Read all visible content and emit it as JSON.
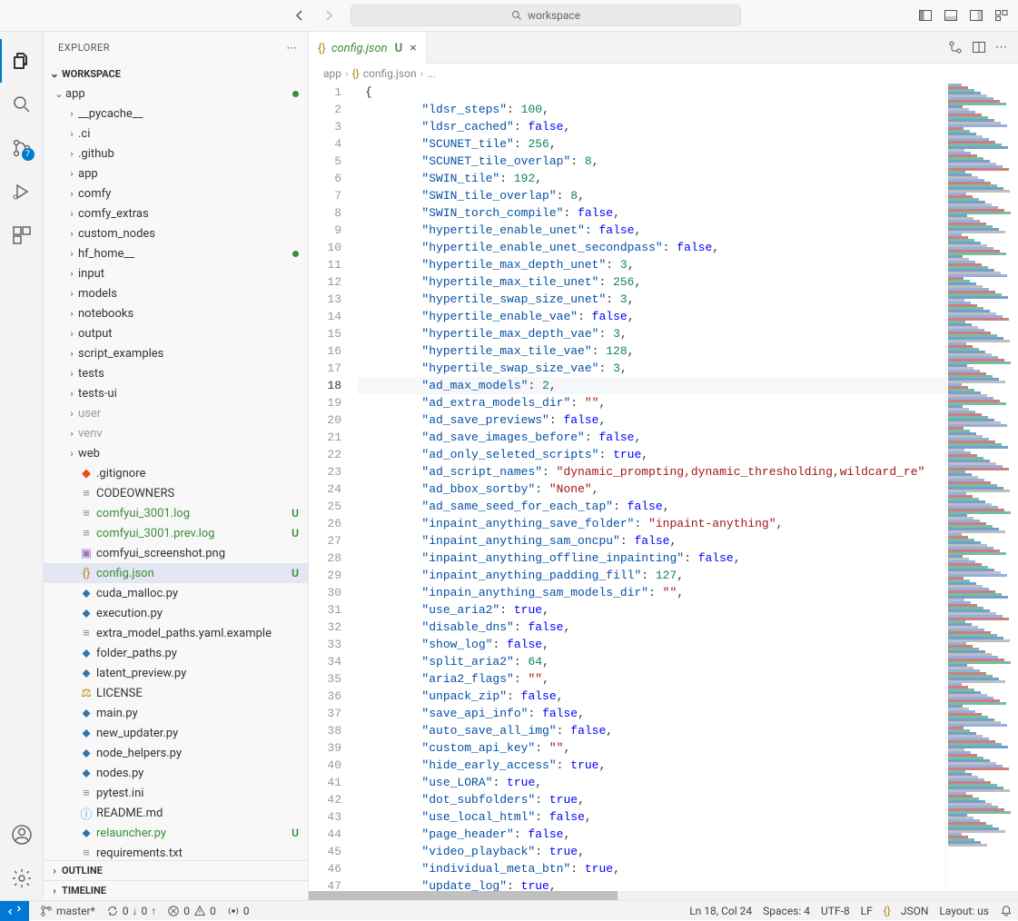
{
  "titlebar": {
    "search_text": "workspace"
  },
  "activitybar": {
    "scm_badge": "7"
  },
  "sidebar": {
    "title": "EXPLORER",
    "workspace_label": "WORKSPACE",
    "outline_label": "OUTLINE",
    "timeline_label": "TIMELINE",
    "tree": [
      {
        "type": "folder",
        "label": "app",
        "depth": 0,
        "expanded": true,
        "modified": true
      },
      {
        "type": "folder",
        "label": "__pycache__",
        "depth": 1,
        "expanded": false
      },
      {
        "type": "folder",
        "label": ".ci",
        "depth": 1,
        "expanded": false
      },
      {
        "type": "folder",
        "label": ".github",
        "depth": 1,
        "expanded": false
      },
      {
        "type": "folder",
        "label": "app",
        "depth": 1,
        "expanded": false
      },
      {
        "type": "folder",
        "label": "comfy",
        "depth": 1,
        "expanded": false
      },
      {
        "type": "folder",
        "label": "comfy_extras",
        "depth": 1,
        "expanded": false
      },
      {
        "type": "folder",
        "label": "custom_nodes",
        "depth": 1,
        "expanded": false
      },
      {
        "type": "folder",
        "label": "hf_home__",
        "depth": 1,
        "expanded": false,
        "modified": true
      },
      {
        "type": "folder",
        "label": "input",
        "depth": 1,
        "expanded": false
      },
      {
        "type": "folder",
        "label": "models",
        "depth": 1,
        "expanded": false
      },
      {
        "type": "folder",
        "label": "notebooks",
        "depth": 1,
        "expanded": false
      },
      {
        "type": "folder",
        "label": "output",
        "depth": 1,
        "expanded": false
      },
      {
        "type": "folder",
        "label": "script_examples",
        "depth": 1,
        "expanded": false
      },
      {
        "type": "folder",
        "label": "tests",
        "depth": 1,
        "expanded": false
      },
      {
        "type": "folder",
        "label": "tests-ui",
        "depth": 1,
        "expanded": false
      },
      {
        "type": "folder",
        "label": "user",
        "depth": 1,
        "expanded": false,
        "dim": true
      },
      {
        "type": "folder",
        "label": "venv",
        "depth": 1,
        "expanded": false,
        "dim": true
      },
      {
        "type": "folder",
        "label": "web",
        "depth": 1,
        "expanded": false
      },
      {
        "type": "file",
        "label": ".gitignore",
        "depth": 1,
        "icon": "git"
      },
      {
        "type": "file",
        "label": "CODEOWNERS",
        "depth": 1,
        "icon": "txt"
      },
      {
        "type": "file",
        "label": "comfyui_3001.log",
        "depth": 1,
        "icon": "txt",
        "untracked": true,
        "badge": "U"
      },
      {
        "type": "file",
        "label": "comfyui_3001.prev.log",
        "depth": 1,
        "icon": "txt",
        "untracked": true,
        "badge": "U"
      },
      {
        "type": "file",
        "label": "comfyui_screenshot.png",
        "depth": 1,
        "icon": "img"
      },
      {
        "type": "file",
        "label": "config.json",
        "depth": 1,
        "icon": "json",
        "untracked": true,
        "badge": "U",
        "selected": true
      },
      {
        "type": "file",
        "label": "cuda_malloc.py",
        "depth": 1,
        "icon": "py"
      },
      {
        "type": "file",
        "label": "execution.py",
        "depth": 1,
        "icon": "py"
      },
      {
        "type": "file",
        "label": "extra_model_paths.yaml.example",
        "depth": 1,
        "icon": "txt"
      },
      {
        "type": "file",
        "label": "folder_paths.py",
        "depth": 1,
        "icon": "py"
      },
      {
        "type": "file",
        "label": "latent_preview.py",
        "depth": 1,
        "icon": "py"
      },
      {
        "type": "file",
        "label": "LICENSE",
        "depth": 1,
        "icon": "lic"
      },
      {
        "type": "file",
        "label": "main.py",
        "depth": 1,
        "icon": "py"
      },
      {
        "type": "file",
        "label": "new_updater.py",
        "depth": 1,
        "icon": "py"
      },
      {
        "type": "file",
        "label": "node_helpers.py",
        "depth": 1,
        "icon": "py"
      },
      {
        "type": "file",
        "label": "nodes.py",
        "depth": 1,
        "icon": "py"
      },
      {
        "type": "file",
        "label": "pytest.ini",
        "depth": 1,
        "icon": "txt"
      },
      {
        "type": "file",
        "label": "README.md",
        "depth": 1,
        "icon": "md"
      },
      {
        "type": "file",
        "label": "relauncher.py",
        "depth": 1,
        "icon": "py",
        "untracked": true,
        "badge": "U"
      },
      {
        "type": "file",
        "label": "requirements.txt",
        "depth": 1,
        "icon": "txt"
      }
    ]
  },
  "tab": {
    "filename": "config.json",
    "status": "U"
  },
  "breadcrumb": {
    "parts": [
      "app",
      "config.json",
      "..."
    ]
  },
  "editor": {
    "active_line": 18,
    "lines": [
      {
        "n": 1,
        "tokens": [
          {
            "t": "brace",
            "v": "{"
          }
        ]
      },
      {
        "n": 2,
        "indent": 2,
        "key": "ldsr_steps",
        "vtype": "num",
        "v": "100",
        "comma": true
      },
      {
        "n": 3,
        "indent": 2,
        "key": "ldsr_cached",
        "vtype": "bool",
        "v": "false",
        "comma": true
      },
      {
        "n": 4,
        "indent": 2,
        "key": "SCUNET_tile",
        "vtype": "num",
        "v": "256",
        "comma": true
      },
      {
        "n": 5,
        "indent": 2,
        "key": "SCUNET_tile_overlap",
        "vtype": "num",
        "v": "8",
        "comma": true
      },
      {
        "n": 6,
        "indent": 2,
        "key": "SWIN_tile",
        "vtype": "num",
        "v": "192",
        "comma": true
      },
      {
        "n": 7,
        "indent": 2,
        "key": "SWIN_tile_overlap",
        "vtype": "num",
        "v": "8",
        "comma": true
      },
      {
        "n": 8,
        "indent": 2,
        "key": "SWIN_torch_compile",
        "vtype": "bool",
        "v": "false",
        "comma": true
      },
      {
        "n": 9,
        "indent": 2,
        "key": "hypertile_enable_unet",
        "vtype": "bool",
        "v": "false",
        "comma": true
      },
      {
        "n": 10,
        "indent": 2,
        "key": "hypertile_enable_unet_secondpass",
        "vtype": "bool",
        "v": "false",
        "comma": true
      },
      {
        "n": 11,
        "indent": 2,
        "key": "hypertile_max_depth_unet",
        "vtype": "num",
        "v": "3",
        "comma": true
      },
      {
        "n": 12,
        "indent": 2,
        "key": "hypertile_max_tile_unet",
        "vtype": "num",
        "v": "256",
        "comma": true
      },
      {
        "n": 13,
        "indent": 2,
        "key": "hypertile_swap_size_unet",
        "vtype": "num",
        "v": "3",
        "comma": true
      },
      {
        "n": 14,
        "indent": 2,
        "key": "hypertile_enable_vae",
        "vtype": "bool",
        "v": "false",
        "comma": true
      },
      {
        "n": 15,
        "indent": 2,
        "key": "hypertile_max_depth_vae",
        "vtype": "num",
        "v": "3",
        "comma": true
      },
      {
        "n": 16,
        "indent": 2,
        "key": "hypertile_max_tile_vae",
        "vtype": "num",
        "v": "128",
        "comma": true
      },
      {
        "n": 17,
        "indent": 2,
        "key": "hypertile_swap_size_vae",
        "vtype": "num",
        "v": "3",
        "comma": true
      },
      {
        "n": 18,
        "indent": 2,
        "key": "ad_max_models",
        "vtype": "num",
        "v": "2",
        "comma": true
      },
      {
        "n": 19,
        "indent": 2,
        "key": "ad_extra_models_dir",
        "vtype": "str",
        "v": "",
        "comma": true
      },
      {
        "n": 20,
        "indent": 2,
        "key": "ad_save_previews",
        "vtype": "bool",
        "v": "false",
        "comma": true
      },
      {
        "n": 21,
        "indent": 2,
        "key": "ad_save_images_before",
        "vtype": "bool",
        "v": "false",
        "comma": true
      },
      {
        "n": 22,
        "indent": 2,
        "key": "ad_only_seleted_scripts",
        "vtype": "bool",
        "v": "true",
        "comma": true
      },
      {
        "n": 23,
        "indent": 2,
        "key": "ad_script_names",
        "vtype": "str",
        "v": "dynamic_prompting,dynamic_thresholding,wildcard_re",
        "comma": false,
        "truncated": true
      },
      {
        "n": 24,
        "indent": 2,
        "key": "ad_bbox_sortby",
        "vtype": "str",
        "v": "None",
        "comma": true
      },
      {
        "n": 25,
        "indent": 2,
        "key": "ad_same_seed_for_each_tap",
        "vtype": "bool",
        "v": "false",
        "comma": true
      },
      {
        "n": 26,
        "indent": 2,
        "key": "inpaint_anything_save_folder",
        "vtype": "str",
        "v": "inpaint-anything",
        "comma": true
      },
      {
        "n": 27,
        "indent": 2,
        "key": "inpaint_anything_sam_oncpu",
        "vtype": "bool",
        "v": "false",
        "comma": true
      },
      {
        "n": 28,
        "indent": 2,
        "key": "inpaint_anything_offline_inpainting",
        "vtype": "bool",
        "v": "false",
        "comma": true
      },
      {
        "n": 29,
        "indent": 2,
        "key": "inpaint_anything_padding_fill",
        "vtype": "num",
        "v": "127",
        "comma": true
      },
      {
        "n": 30,
        "indent": 2,
        "key": "inpain_anything_sam_models_dir",
        "vtype": "str",
        "v": "",
        "comma": true
      },
      {
        "n": 31,
        "indent": 2,
        "key": "use_aria2",
        "vtype": "bool",
        "v": "true",
        "comma": true
      },
      {
        "n": 32,
        "indent": 2,
        "key": "disable_dns",
        "vtype": "bool",
        "v": "false",
        "comma": true
      },
      {
        "n": 33,
        "indent": 2,
        "key": "show_log",
        "vtype": "bool",
        "v": "false",
        "comma": true
      },
      {
        "n": 34,
        "indent": 2,
        "key": "split_aria2",
        "vtype": "num",
        "v": "64",
        "comma": true
      },
      {
        "n": 35,
        "indent": 2,
        "key": "aria2_flags",
        "vtype": "str",
        "v": "",
        "comma": true
      },
      {
        "n": 36,
        "indent": 2,
        "key": "unpack_zip",
        "vtype": "bool",
        "v": "false",
        "comma": true
      },
      {
        "n": 37,
        "indent": 2,
        "key": "save_api_info",
        "vtype": "bool",
        "v": "false",
        "comma": true
      },
      {
        "n": 38,
        "indent": 2,
        "key": "auto_save_all_img",
        "vtype": "bool",
        "v": "false",
        "comma": true
      },
      {
        "n": 39,
        "indent": 2,
        "key": "custom_api_key",
        "vtype": "str",
        "v": "",
        "comma": true
      },
      {
        "n": 40,
        "indent": 2,
        "key": "hide_early_access",
        "vtype": "bool",
        "v": "true",
        "comma": true
      },
      {
        "n": 41,
        "indent": 2,
        "key": "use_LORA",
        "vtype": "bool",
        "v": "true",
        "comma": true
      },
      {
        "n": 42,
        "indent": 2,
        "key": "dot_subfolders",
        "vtype": "bool",
        "v": "true",
        "comma": true
      },
      {
        "n": 43,
        "indent": 2,
        "key": "use_local_html",
        "vtype": "bool",
        "v": "false",
        "comma": true
      },
      {
        "n": 44,
        "indent": 2,
        "key": "page_header",
        "vtype": "bool",
        "v": "false",
        "comma": true
      },
      {
        "n": 45,
        "indent": 2,
        "key": "video_playback",
        "vtype": "bool",
        "v": "true",
        "comma": true
      },
      {
        "n": 46,
        "indent": 2,
        "key": "individual_meta_btn",
        "vtype": "bool",
        "v": "true",
        "comma": true
      },
      {
        "n": 47,
        "indent": 2,
        "key": "update_log",
        "vtype": "bool",
        "v": "true",
        "comma": true
      }
    ]
  },
  "statusbar": {
    "branch": "master*",
    "sync_down": "0",
    "sync_up": "0",
    "errors": "0",
    "warnings": "0",
    "ports": "0",
    "line_col": "Ln 18, Col 24",
    "spaces": "Spaces: 4",
    "encoding": "UTF-8",
    "eol": "LF",
    "lang": "JSON",
    "layout": "Layout: us"
  }
}
